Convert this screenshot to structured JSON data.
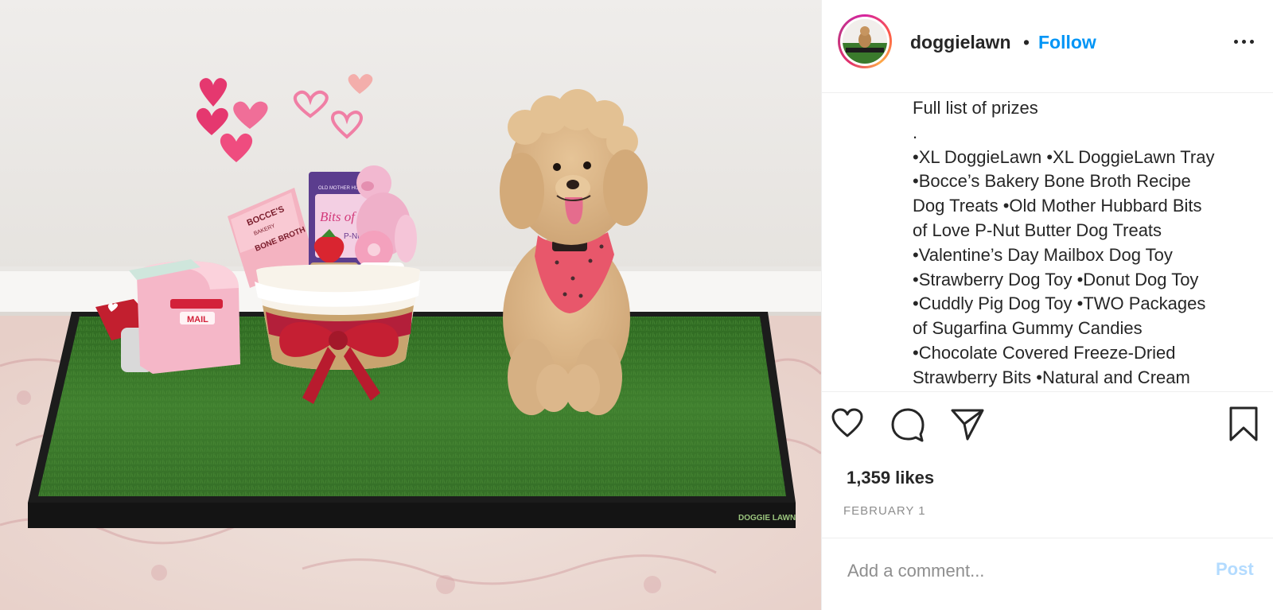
{
  "post": {
    "image_alt": "Poodle dog sitting on a DoggieLawn grass mat next to a Valentine's gift basket",
    "products": {
      "bag1_brand": "BOCCE'S",
      "bag1_sub": "BAKERY",
      "bag1_name": "BONE BROTH",
      "bag2_brand": "OLD MOTHER HUBBARD",
      "bag2_name": "Bits of Love",
      "bag2_sub": "P-Nut",
      "mailbox_label": "MAIL",
      "tray_brand": "DOGGIE LAWN"
    }
  },
  "header": {
    "username": "doggielawn",
    "separator": "•",
    "follow_label": "Follow"
  },
  "caption": {
    "lines": [
      "Full list of prizes",
      ".",
      "•XL DoggieLawn •XL DoggieLawn Tray",
      "•Bocce’s Bakery Bone Broth Recipe",
      "Dog Treats •Old Mother Hubbard Bits",
      "of Love P-Nut Butter Dog Treats",
      "•Valentine’s Day Mailbox Dog Toy",
      "•Strawberry Dog Toy •Donut Dog Toy",
      "•Cuddly Pig Dog Toy •TWO Packages",
      "of Sugarfina Gummy Candies",
      "•Chocolate Covered Freeze-Dried",
      "Strawberry Bits •Natural and Cream"
    ]
  },
  "actions": {
    "like_icon": "heart-icon",
    "comment_icon": "comment-icon",
    "share_icon": "paper-plane-icon",
    "save_icon": "bookmark-icon"
  },
  "likes": "1,359 likes",
  "date": "FEBRUARY 1",
  "comment": {
    "placeholder": "Add a comment...",
    "post_label": "Post"
  },
  "colors": {
    "follow": "#0095f6",
    "post_disabled": "#b3dbff",
    "grass": "#3e7a2c",
    "dog": "#d9b384"
  }
}
